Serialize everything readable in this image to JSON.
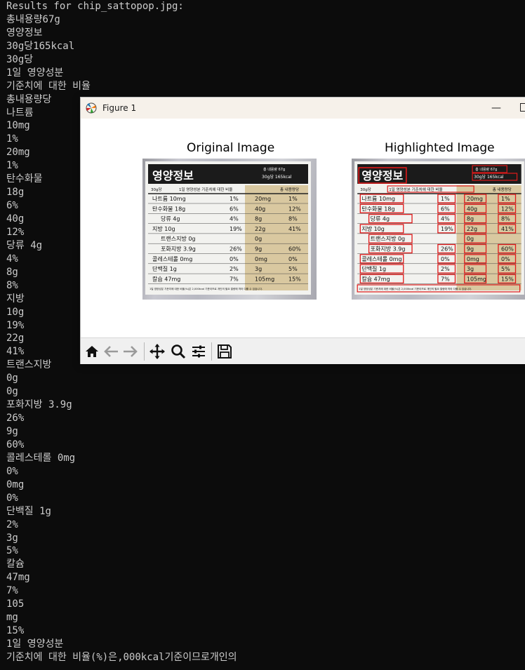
{
  "terminal": {
    "lines": [
      "Results for chip_sattopop.jpg:",
      "총내용량67g",
      "영양정보",
      "30g당165kcal",
      "30g당",
      "1일 영양성분",
      "기준치에 대한 비율",
      "총내용량당",
      "나트륨",
      "10mg",
      "1%",
      "20mg",
      "1%",
      "탄수화물",
      "18g",
      "6%",
      "40g",
      "12%",
      "당류 4g",
      "4%",
      "8g",
      "8%",
      "지방",
      "10g",
      "19%",
      "22g",
      "41%",
      "트랜스지방",
      "0g",
      "0g",
      "포화지방 3.9g",
      "26%",
      "9g",
      "60%",
      "콜레스테롤 0mg",
      "0%",
      "0mg",
      "0%",
      "단백질 1g",
      "2%",
      "3g",
      "5%",
      "칼슘",
      "47mg",
      "7%",
      "105",
      "mg",
      "15%",
      "1일 영양성분",
      "기준치에 대한 비율(%)은,000kcal기준이므로개인의"
    ]
  },
  "figure": {
    "window_title": "Figure 1",
    "left_title": "Original Image",
    "right_title": "Highlighted Image",
    "label": {
      "header": "영양정보",
      "total_amount": "총 내용량 67g",
      "kcal": "30g당 165kcal",
      "per_serving": "30g당",
      "daily_ratio": "1일 영양성분 기준치에 대한 비율",
      "total_per": "총 내용량당",
      "rows": [
        {
          "name": "나트륨 10mg",
          "pct": "1%",
          "amt": "20mg",
          "pct2": "1%"
        },
        {
          "name": "탄수화물 18g",
          "pct": "6%",
          "amt": "40g",
          "pct2": "12%"
        },
        {
          "name": "당류 4g",
          "pct": "4%",
          "amt": "8g",
          "pct2": "8%"
        },
        {
          "name": "지방 10g",
          "pct": "19%",
          "amt": "22g",
          "pct2": "41%"
        },
        {
          "name": "트랜스지방 0g",
          "pct": "",
          "amt": "0g",
          "pct2": ""
        },
        {
          "name": "포화지방 3.9g",
          "pct": "26%",
          "amt": "9g",
          "pct2": "60%"
        },
        {
          "name": "콜레스테롤 0mg",
          "pct": "0%",
          "amt": "0mg",
          "pct2": "0%"
        },
        {
          "name": "단백질 1g",
          "pct": "2%",
          "amt": "3g",
          "pct2": "5%"
        },
        {
          "name": "칼슘 47mg",
          "pct": "7%",
          "amt": "105mg",
          "pct2": "15%"
        }
      ],
      "footnote": "1일 영양성분 기준치에 대한 비율(%)은 2,000kcal 기준이므로 개인의 필요 열량에 따라 다를 수 있습니다."
    },
    "toolbar": {
      "home": "home-icon",
      "back": "back-arrow-icon",
      "forward": "forward-arrow-icon",
      "pan": "pan-move-icon",
      "zoom": "zoom-magnifier-icon",
      "configure": "configure-subplots-icon",
      "save": "save-floppy-icon"
    },
    "colors": {
      "highlight_box": "#e01a1a",
      "terminal_bg": "#0c0c0c",
      "terminal_fg": "#cccccc"
    }
  }
}
